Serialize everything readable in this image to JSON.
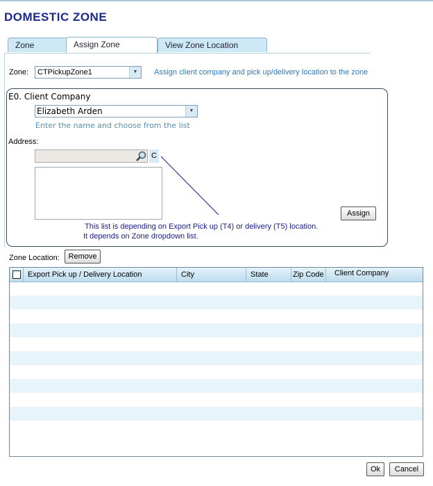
{
  "page": {
    "title": "DOMESTIC ZONE"
  },
  "tabs": [
    {
      "label": "Zone"
    },
    {
      "label": "Assign Zone",
      "active": true
    },
    {
      "label": "View Zone Location"
    }
  ],
  "zone": {
    "label": "Zone:",
    "value": "CTPickupZone1",
    "hint": "Assign client company and pick up/delivery location to the zone"
  },
  "client": {
    "heading": "E0. Client Company",
    "value": "Elizabeth Arden",
    "hint": "Enter the name and choose from the list"
  },
  "address": {
    "label": "Address:",
    "value": "",
    "clear_label": "C",
    "search_icon": "magnifier-icon"
  },
  "assign_label": "Assign",
  "notes": [
    "This list is depending on Export Pick up (T4) or delivery (T5) location.",
    "It depends on Zone dropdown list."
  ],
  "zone_location": {
    "label": "Zone Location:",
    "remove_label": "Remove"
  },
  "table": {
    "columns": [
      "Export Pick up / Delivery Location",
      "City",
      "State",
      "Zip Code",
      "Client Company"
    ],
    "rows": []
  },
  "footer": {
    "ok_label": "Ok",
    "cancel_label": "Cancel"
  },
  "colors": {
    "title": "#1a2a8c",
    "hint": "#2a7ac0",
    "note": "#1a1a8a",
    "tab": "#cde9f5",
    "row_alt": "#e8f4fb"
  }
}
